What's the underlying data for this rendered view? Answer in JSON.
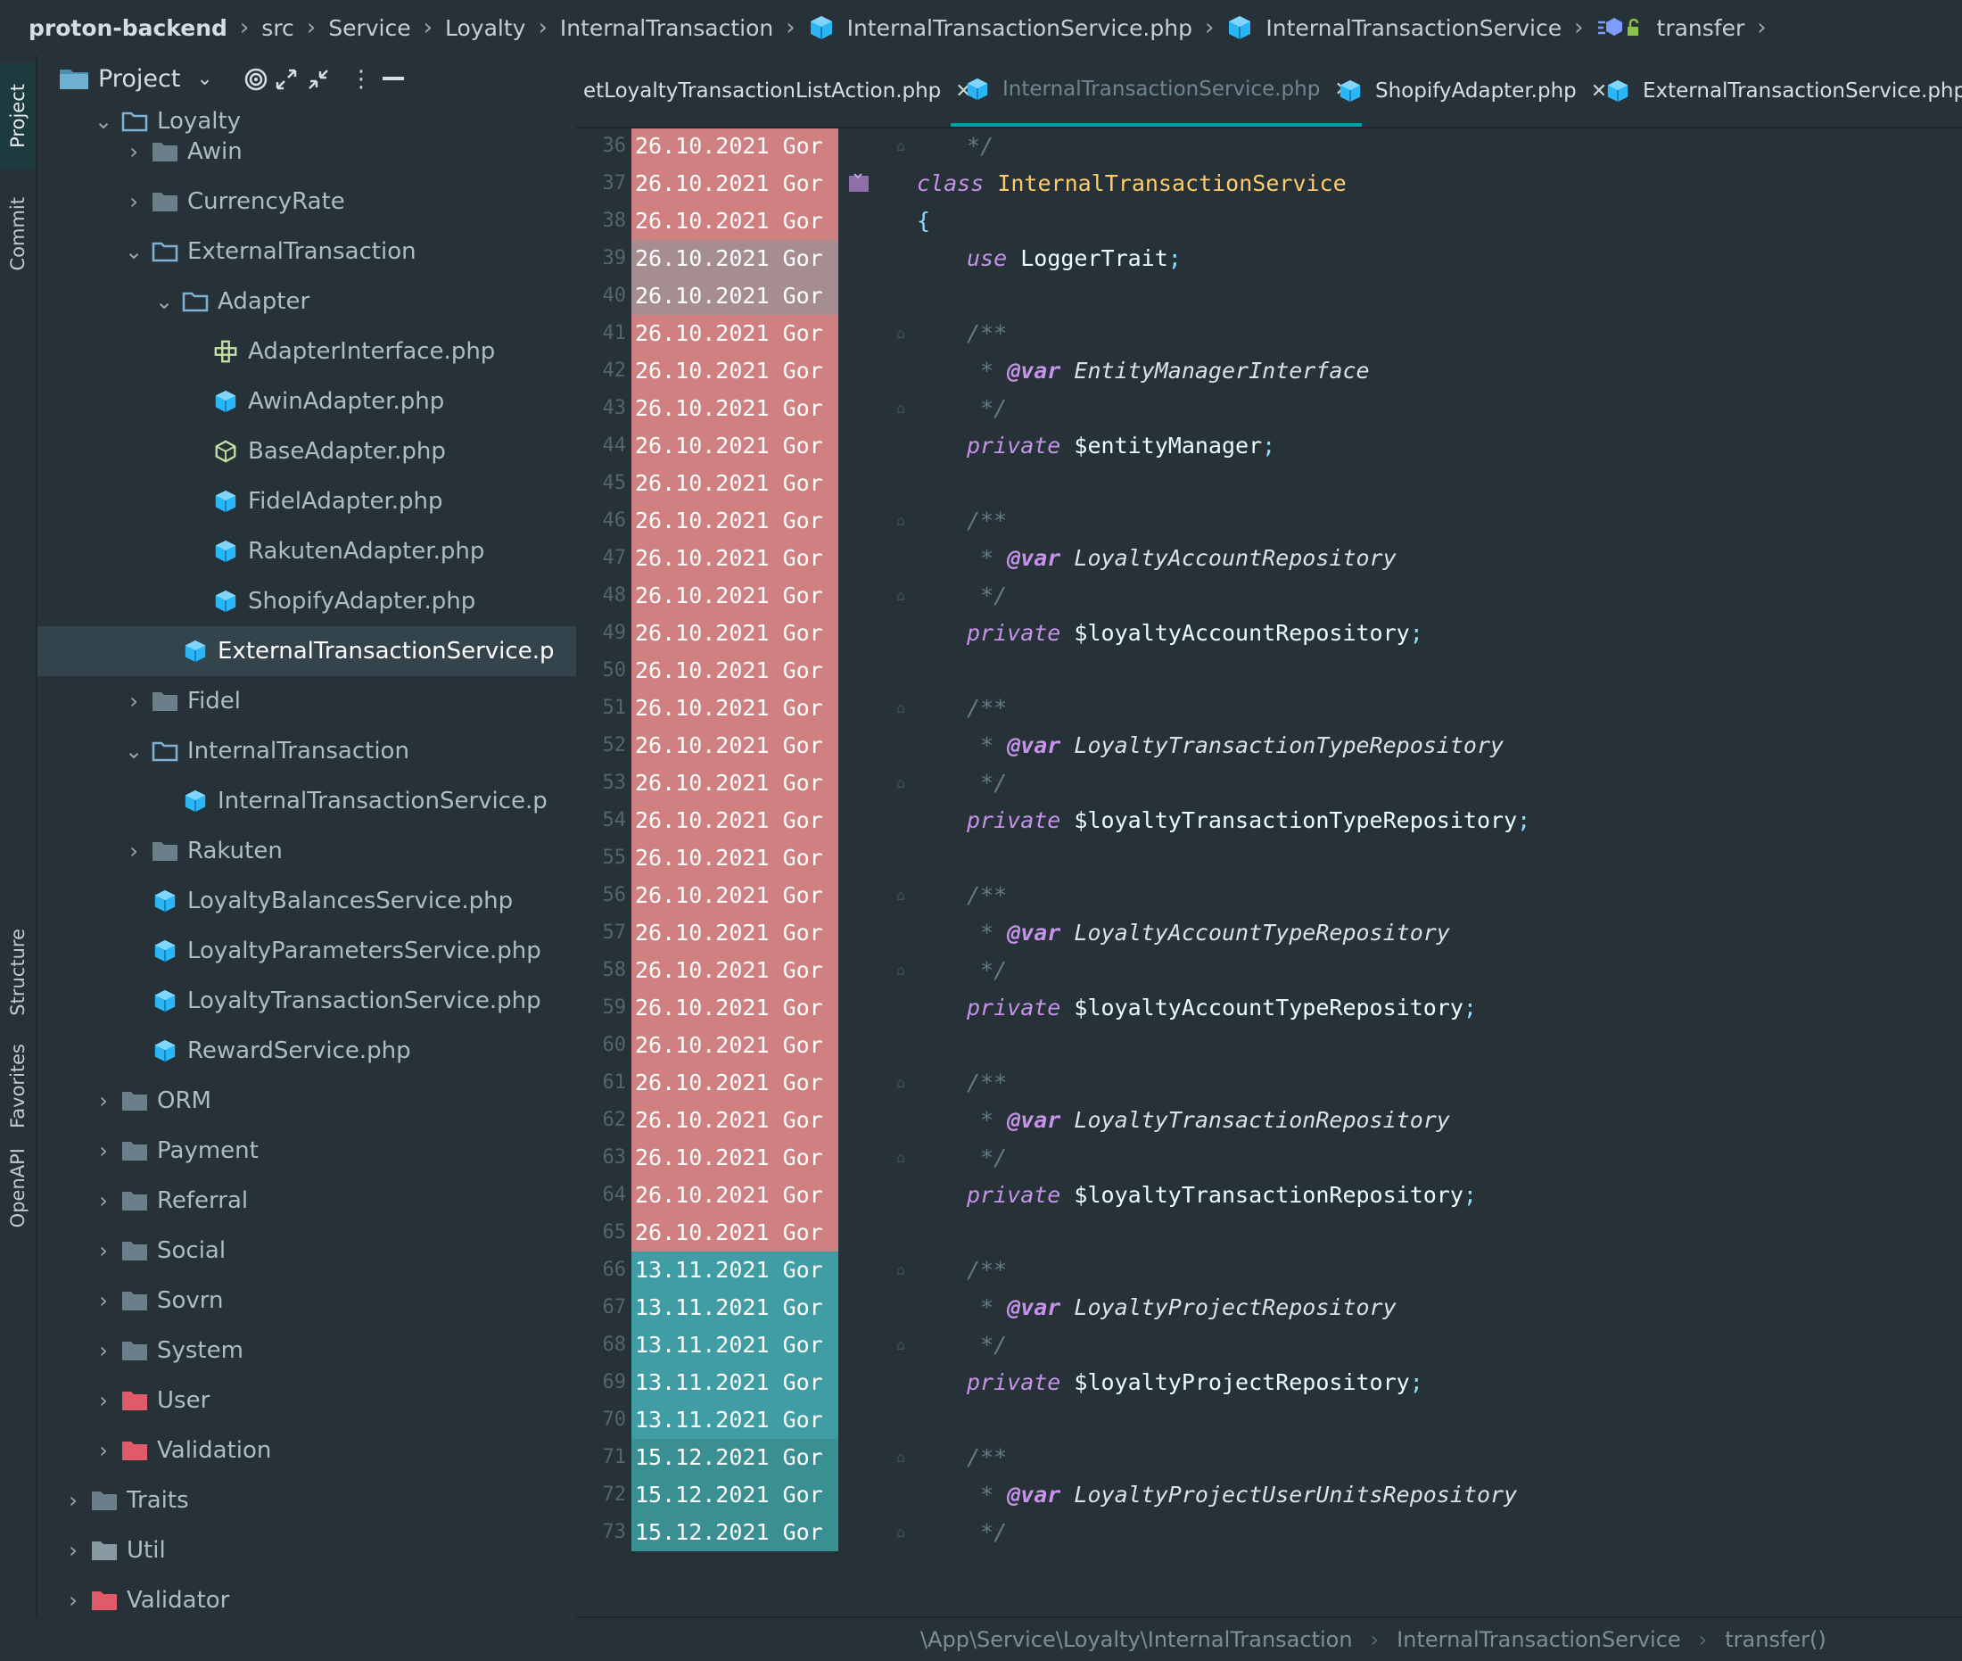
{
  "breadcrumb": [
    {
      "label": "proton-backend",
      "icon": ""
    },
    {
      "label": "src",
      "icon": ""
    },
    {
      "label": "Service",
      "icon": ""
    },
    {
      "label": "Loyalty",
      "icon": ""
    },
    {
      "label": "InternalTransaction",
      "icon": ""
    },
    {
      "label": "InternalTransactionService.php",
      "icon": "php-class-icon"
    },
    {
      "label": "InternalTransactionService",
      "icon": "php-class-icon"
    },
    {
      "label": "transfer",
      "icon": "method-icon"
    }
  ],
  "toolstrip": {
    "project": "Project",
    "commit": "Commit",
    "structure": "Structure",
    "favorites": "Favorites",
    "openapi": "OpenAPI"
  },
  "project_panel": {
    "title": "Project",
    "tree": [
      {
        "label": "Loyalty",
        "type": "folder-open",
        "depth": 0
      },
      {
        "label": "Awin",
        "type": "folder",
        "depth": 1
      },
      {
        "label": "CurrencyRate",
        "type": "folder",
        "depth": 1
      },
      {
        "label": "ExternalTransaction",
        "type": "folder-open",
        "depth": 1
      },
      {
        "label": "Adapter",
        "type": "folder-open",
        "depth": 2
      },
      {
        "label": "AdapterInterface.php",
        "type": "interface",
        "depth": 3
      },
      {
        "label": "AwinAdapter.php",
        "type": "php",
        "depth": 3
      },
      {
        "label": "BaseAdapter.php",
        "type": "php-abstract",
        "depth": 3
      },
      {
        "label": "FidelAdapter.php",
        "type": "php",
        "depth": 3
      },
      {
        "label": "RakutenAdapter.php",
        "type": "php",
        "depth": 3
      },
      {
        "label": "ShopifyAdapter.php",
        "type": "php",
        "depth": 3
      },
      {
        "label": "ExternalTransactionService.p",
        "type": "php",
        "depth": 2,
        "selected": true
      },
      {
        "label": "Fidel",
        "type": "folder",
        "depth": 1
      },
      {
        "label": "InternalTransaction",
        "type": "folder-open",
        "depth": 1
      },
      {
        "label": "InternalTransactionService.p",
        "type": "php",
        "depth": 2
      },
      {
        "label": "Rakuten",
        "type": "folder",
        "depth": 1
      },
      {
        "label": "LoyaltyBalancesService.php",
        "type": "php",
        "depth": 1
      },
      {
        "label": "LoyaltyParametersService.php",
        "type": "php",
        "depth": 1
      },
      {
        "label": "LoyaltyTransactionService.php",
        "type": "php",
        "depth": 1
      },
      {
        "label": "RewardService.php",
        "type": "php",
        "depth": 1
      },
      {
        "label": "ORM",
        "type": "folder",
        "depth": 0
      },
      {
        "label": "Payment",
        "type": "folder",
        "depth": 0
      },
      {
        "label": "Referral",
        "type": "folder",
        "depth": 0
      },
      {
        "label": "Social",
        "type": "folder",
        "depth": 0
      },
      {
        "label": "Sovrn",
        "type": "folder",
        "depth": 0
      },
      {
        "label": "System",
        "type": "folder",
        "depth": 0
      },
      {
        "label": "User",
        "type": "folder-red",
        "depth": 0
      },
      {
        "label": "Validation",
        "type": "folder-red",
        "depth": 0
      },
      {
        "label": "Traits",
        "type": "folder",
        "depth": -1
      },
      {
        "label": "Util",
        "type": "folder-link",
        "depth": -1
      },
      {
        "label": "Validator",
        "type": "folder-red",
        "depth": -1
      }
    ]
  },
  "tabs": [
    {
      "label": "etLoyaltyTransactionListAction.php",
      "active": false,
      "icon": ""
    },
    {
      "label": "InternalTransactionService.php",
      "active": true,
      "icon": "php-class-icon"
    },
    {
      "label": "ShopifyAdapter.php",
      "active": false,
      "icon": "php-class-icon"
    },
    {
      "label": "ExternalTransactionService.php",
      "active": false,
      "icon": "php-class-icon"
    }
  ],
  "colors": {
    "blame_old": "#d08080",
    "blame_old_muted": "#a58d92",
    "blame_mid": "#3f9da3",
    "blame_new": "#3a8f93",
    "keyword": "#c792ea",
    "class_name": "#ffcb6b",
    "comment": "#627b86"
  },
  "lines": [
    {
      "n": "36",
      "blame": "26.10.2021 Gor",
      "code": [
        [
          "cm",
          "*/"
        ]
      ],
      "indent": 1
    },
    {
      "n": "37",
      "blame": "26.10.2021 Gor",
      "code": [
        [
          "kw",
          "class "
        ],
        [
          "cls",
          "InternalTransactionService"
        ]
      ],
      "indent": 0
    },
    {
      "n": "38",
      "blame": "26.10.2021 Gor",
      "code": [
        [
          "punc",
          "{"
        ]
      ],
      "indent": 0
    },
    {
      "n": "39",
      "blame": "26.10.2021 Gor",
      "code": [
        [
          "kw",
          "use "
        ],
        [
          "var",
          "LoggerTrait"
        ],
        [
          "punc",
          ";"
        ]
      ],
      "indent": 1
    },
    {
      "n": "40",
      "blame": "26.10.2021 Gor",
      "code": [],
      "indent": 0
    },
    {
      "n": "41",
      "blame": "26.10.2021 Gor",
      "code": [
        [
          "cm",
          "/**"
        ]
      ],
      "indent": 1
    },
    {
      "n": "42",
      "blame": "26.10.2021 Gor",
      "code": [
        [
          "cm",
          " * "
        ],
        [
          "tag",
          "@var "
        ],
        [
          "type",
          "EntityManagerInterface"
        ]
      ],
      "indent": 1
    },
    {
      "n": "43",
      "blame": "26.10.2021 Gor",
      "code": [
        [
          "cm",
          " */"
        ]
      ],
      "indent": 1
    },
    {
      "n": "44",
      "blame": "26.10.2021 Gor",
      "code": [
        [
          "kw",
          "private "
        ],
        [
          "var",
          "$entityManager"
        ],
        [
          "punc",
          ";"
        ]
      ],
      "indent": 1
    },
    {
      "n": "45",
      "blame": "26.10.2021 Gor",
      "code": [],
      "indent": 0
    },
    {
      "n": "46",
      "blame": "26.10.2021 Gor",
      "code": [
        [
          "cm",
          "/**"
        ]
      ],
      "indent": 1
    },
    {
      "n": "47",
      "blame": "26.10.2021 Gor",
      "code": [
        [
          "cm",
          " * "
        ],
        [
          "tag",
          "@var "
        ],
        [
          "type",
          "LoyaltyAccountRepository"
        ]
      ],
      "indent": 1
    },
    {
      "n": "48",
      "blame": "26.10.2021 Gor",
      "code": [
        [
          "cm",
          " */"
        ]
      ],
      "indent": 1
    },
    {
      "n": "49",
      "blame": "26.10.2021 Gor",
      "code": [
        [
          "kw",
          "private "
        ],
        [
          "var",
          "$loyaltyAccountRepository"
        ],
        [
          "punc",
          ";"
        ]
      ],
      "indent": 1
    },
    {
      "n": "50",
      "blame": "26.10.2021 Gor",
      "code": [],
      "indent": 0
    },
    {
      "n": "51",
      "blame": "26.10.2021 Gor",
      "code": [
        [
          "cm",
          "/**"
        ]
      ],
      "indent": 1
    },
    {
      "n": "52",
      "blame": "26.10.2021 Gor",
      "code": [
        [
          "cm",
          " * "
        ],
        [
          "tag",
          "@var "
        ],
        [
          "type",
          "LoyaltyTransactionTypeRepository"
        ]
      ],
      "indent": 1
    },
    {
      "n": "53",
      "blame": "26.10.2021 Gor",
      "code": [
        [
          "cm",
          " */"
        ]
      ],
      "indent": 1
    },
    {
      "n": "54",
      "blame": "26.10.2021 Gor",
      "code": [
        [
          "kw",
          "private "
        ],
        [
          "var",
          "$loyaltyTransactionTypeRepository"
        ],
        [
          "punc",
          ";"
        ]
      ],
      "indent": 1
    },
    {
      "n": "55",
      "blame": "26.10.2021 Gor",
      "code": [],
      "indent": 0
    },
    {
      "n": "56",
      "blame": "26.10.2021 Gor",
      "code": [
        [
          "cm",
          "/**"
        ]
      ],
      "indent": 1
    },
    {
      "n": "57",
      "blame": "26.10.2021 Gor",
      "code": [
        [
          "cm",
          " * "
        ],
        [
          "tag",
          "@var "
        ],
        [
          "type",
          "LoyaltyAccountTypeRepository"
        ]
      ],
      "indent": 1
    },
    {
      "n": "58",
      "blame": "26.10.2021 Gor",
      "code": [
        [
          "cm",
          " */"
        ]
      ],
      "indent": 1
    },
    {
      "n": "59",
      "blame": "26.10.2021 Gor",
      "code": [
        [
          "kw",
          "private "
        ],
        [
          "var",
          "$loyaltyAccountTypeRepository"
        ],
        [
          "punc",
          ";"
        ]
      ],
      "indent": 1
    },
    {
      "n": "60",
      "blame": "26.10.2021 Gor",
      "code": [],
      "indent": 0
    },
    {
      "n": "61",
      "blame": "26.10.2021 Gor",
      "code": [
        [
          "cm",
          "/**"
        ]
      ],
      "indent": 1
    },
    {
      "n": "62",
      "blame": "26.10.2021 Gor",
      "code": [
        [
          "cm",
          " * "
        ],
        [
          "tag",
          "@var "
        ],
        [
          "type",
          "LoyaltyTransactionRepository"
        ]
      ],
      "indent": 1
    },
    {
      "n": "63",
      "blame": "26.10.2021 Gor",
      "code": [
        [
          "cm",
          " */"
        ]
      ],
      "indent": 1
    },
    {
      "n": "64",
      "blame": "26.10.2021 Gor",
      "code": [
        [
          "kw",
          "private "
        ],
        [
          "var",
          "$loyaltyTransactionRepository"
        ],
        [
          "punc",
          ";"
        ]
      ],
      "indent": 1
    },
    {
      "n": "65",
      "blame": "26.10.2021 Gor",
      "code": [],
      "indent": 0
    },
    {
      "n": "66",
      "blame": "13.11.2021 Gor",
      "code": [
        [
          "cm",
          "/**"
        ]
      ],
      "indent": 1
    },
    {
      "n": "67",
      "blame": "13.11.2021 Gor",
      "code": [
        [
          "cm",
          " * "
        ],
        [
          "tag",
          "@var "
        ],
        [
          "type",
          "LoyaltyProjectRepository"
        ]
      ],
      "indent": 1
    },
    {
      "n": "68",
      "blame": "13.11.2021 Gor",
      "code": [
        [
          "cm",
          " */"
        ]
      ],
      "indent": 1
    },
    {
      "n": "69",
      "blame": "13.11.2021 Gor",
      "code": [
        [
          "kw",
          "private "
        ],
        [
          "var",
          "$loyaltyProjectRepository"
        ],
        [
          "punc",
          ";"
        ]
      ],
      "indent": 1
    },
    {
      "n": "70",
      "blame": "13.11.2021 Gor",
      "code": [],
      "indent": 0
    },
    {
      "n": "71",
      "blame": "15.12.2021 Gor",
      "code": [
        [
          "cm",
          "/**"
        ]
      ],
      "indent": 1
    },
    {
      "n": "72",
      "blame": "15.12.2021 Gor",
      "code": [
        [
          "cm",
          " * "
        ],
        [
          "tag",
          "@var "
        ],
        [
          "type",
          "LoyaltyProjectUserUnitsRepository"
        ]
      ],
      "indent": 1
    },
    {
      "n": "73",
      "blame": "15.12.2021 Gor",
      "code": [
        [
          "cm",
          " */"
        ]
      ],
      "indent": 1
    }
  ],
  "code_breadcrumb": [
    "\\App\\Service\\Loyalty\\InternalTransaction",
    "InternalTransactionService",
    "transfer()"
  ]
}
